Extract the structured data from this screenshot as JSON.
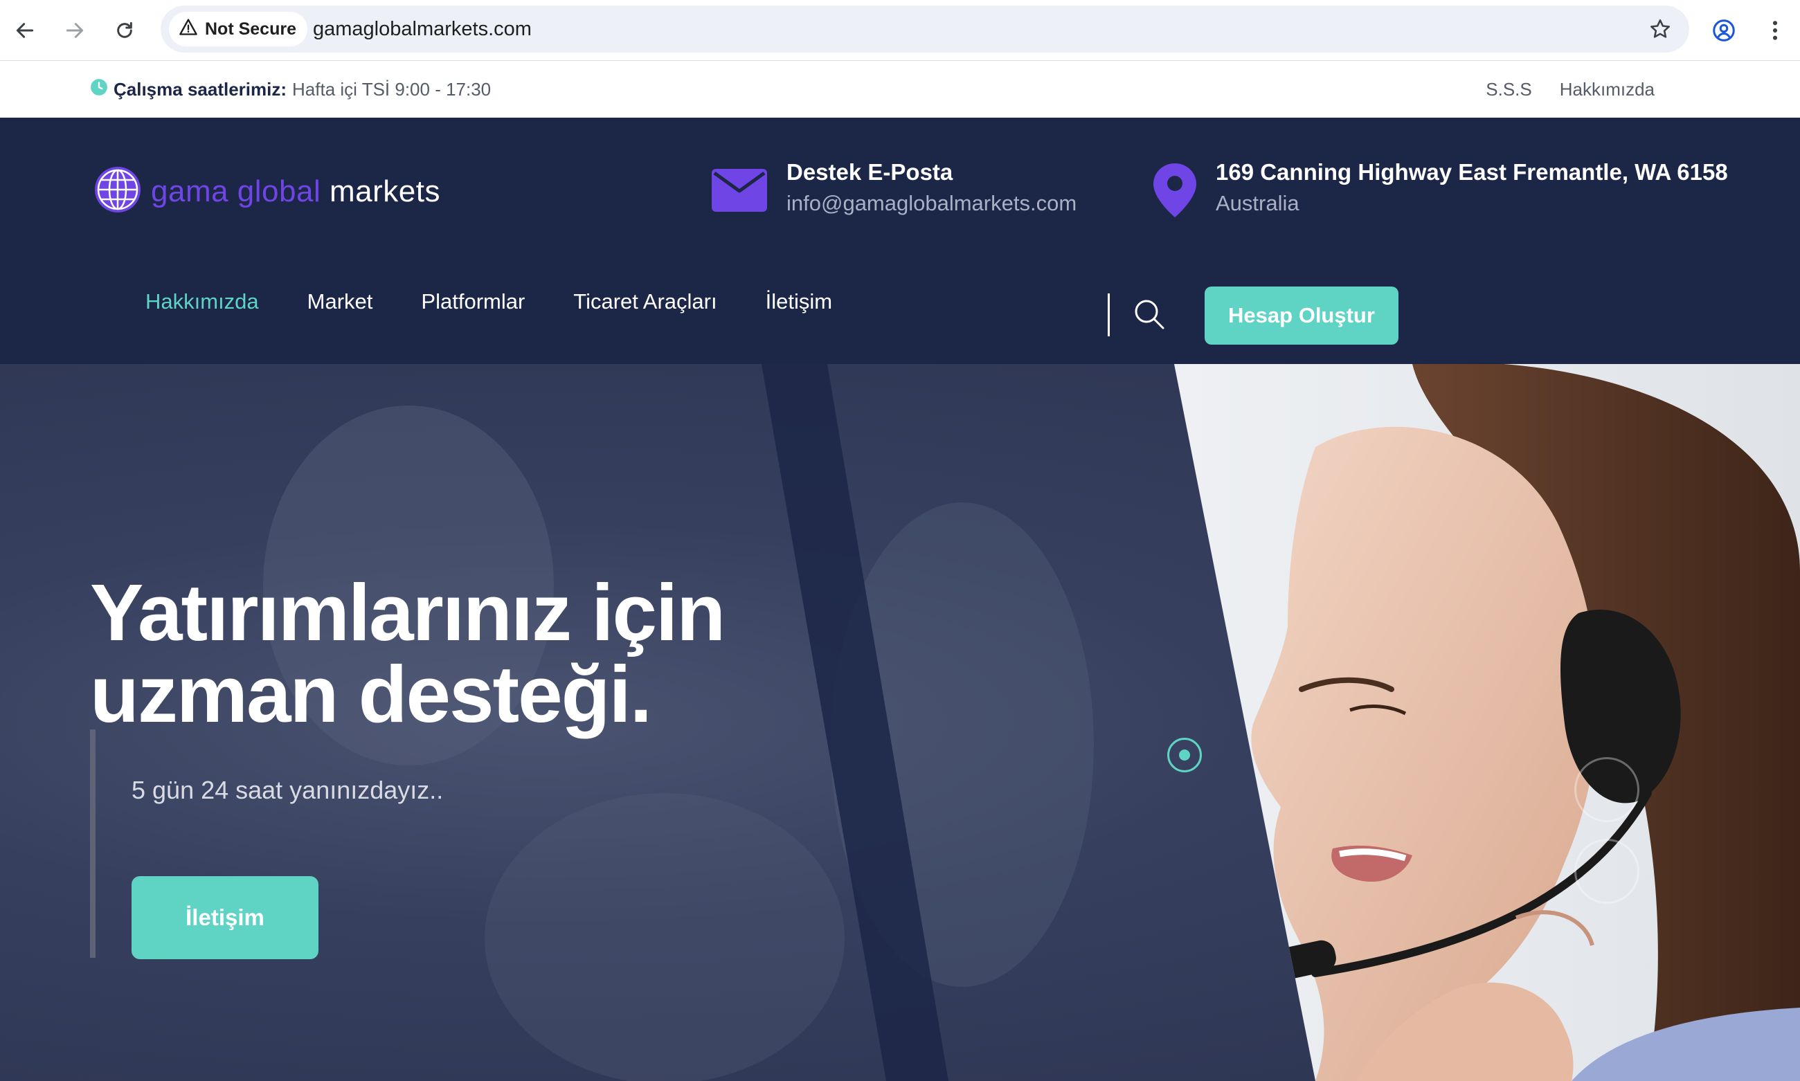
{
  "browser": {
    "security_label": "Not Secure",
    "url": "gamaglobalmarkets.com"
  },
  "topbar": {
    "hours_label": "Çalışma saatlerimiz:",
    "hours_value": "Hafta içi TSİ 9:00 - 17:30",
    "links": [
      "S.S.S",
      "Hakkımızda"
    ]
  },
  "header": {
    "logo_word1": "gama global",
    "logo_word2": "markets",
    "email_title": "Destek E-Posta",
    "email_value": "info@gamaglobalmarkets.com",
    "address_title": "169 Canning Highway East Fremantle, WA 6158",
    "address_value": "Australia"
  },
  "nav": {
    "items": [
      "Hakkımızda",
      "Market",
      "Platformlar",
      "Ticaret Araçları",
      "İletişim"
    ],
    "active": "Hakkımızda",
    "cta": "Hesap Oluştur"
  },
  "hero": {
    "line1": "Yatırımlarınız için",
    "line2": "uzman desteği.",
    "subtitle": "5 gün 24 saat yanınızdayız..",
    "button": "İletişim"
  },
  "colors": {
    "navy": "#1c2647",
    "accent": "#5fd3c4",
    "purple": "#6f45e6"
  },
  "icons": [
    "back-arrow-icon",
    "forward-arrow-icon",
    "reload-icon",
    "warning-icon",
    "star-icon",
    "profile-icon",
    "more-icon",
    "clock-icon",
    "globe-icon",
    "mail-icon",
    "location-pin-icon",
    "search-icon",
    "slider-dot-icon",
    "arrow-left-icon"
  ]
}
